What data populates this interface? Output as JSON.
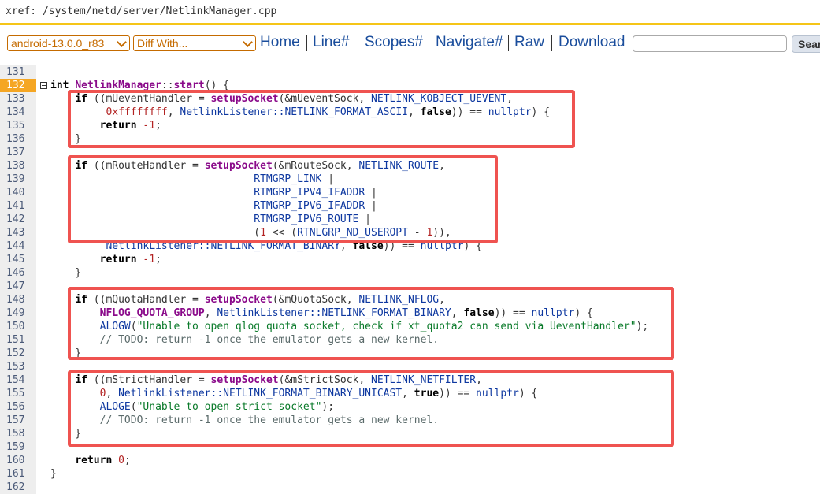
{
  "header": {
    "xref_path": "xref: /system/netd/server/NetlinkManager.cpp"
  },
  "toolbar": {
    "branch_select": "android-13.0.0_r83",
    "diff_select": "Diff With...",
    "links": [
      "Home",
      "Line#",
      "Scopes#",
      "Navigate#",
      "Raw",
      "Download"
    ],
    "search_button": "Search"
  },
  "code": {
    "highlighted_line": "132",
    "lines": [
      {
        "n": "131",
        "segs": []
      },
      {
        "n": "132",
        "segs": [
          [
            "k",
            "int "
          ],
          [
            "fn",
            "NetlinkManager"
          ],
          [
            "p",
            "::"
          ],
          [
            "fn",
            "start"
          ],
          [
            "p",
            "() {"
          ]
        ]
      },
      {
        "n": "133",
        "segs": [
          [
            "p",
            "    "
          ],
          [
            "k",
            "if"
          ],
          [
            "p",
            " (("
          ],
          [
            "mem",
            "mUeventHandler"
          ],
          [
            "p",
            " = "
          ],
          [
            "fn",
            "setupSocket"
          ],
          [
            "p",
            "(&"
          ],
          [
            "mem",
            "mUeventSock"
          ],
          [
            "p",
            ", "
          ],
          [
            "cst",
            "NETLINK_KOBJECT_UEVENT"
          ],
          [
            "p",
            ","
          ]
        ]
      },
      {
        "n": "134",
        "segs": [
          [
            "p",
            "         "
          ],
          [
            "num",
            "0xffffffff"
          ],
          [
            "p",
            ", "
          ],
          [
            "cst",
            "NetlinkListener::NETLINK_FORMAT_ASCII"
          ],
          [
            "p",
            ", "
          ],
          [
            "k",
            "false"
          ],
          [
            "p",
            ")) == "
          ],
          [
            "cst",
            "nullptr"
          ],
          [
            "p",
            ") {"
          ]
        ]
      },
      {
        "n": "135",
        "segs": [
          [
            "p",
            "        "
          ],
          [
            "k",
            "return"
          ],
          [
            "p",
            " "
          ],
          [
            "num",
            "-1"
          ],
          [
            "p",
            ";"
          ]
        ]
      },
      {
        "n": "136",
        "segs": [
          [
            "p",
            "    }"
          ]
        ]
      },
      {
        "n": "137",
        "segs": []
      },
      {
        "n": "138",
        "segs": [
          [
            "p",
            "    "
          ],
          [
            "k",
            "if"
          ],
          [
            "p",
            " (("
          ],
          [
            "mem",
            "mRouteHandler"
          ],
          [
            "p",
            " = "
          ],
          [
            "fn",
            "setupSocket"
          ],
          [
            "p",
            "(&"
          ],
          [
            "mem",
            "mRouteSock"
          ],
          [
            "p",
            ", "
          ],
          [
            "cst",
            "NETLINK_ROUTE"
          ],
          [
            "p",
            ","
          ]
        ]
      },
      {
        "n": "139",
        "segs": [
          [
            "p",
            "                                 "
          ],
          [
            "cst",
            "RTMGRP_LINK"
          ],
          [
            "p",
            " |"
          ]
        ]
      },
      {
        "n": "140",
        "segs": [
          [
            "p",
            "                                 "
          ],
          [
            "cst",
            "RTMGRP_IPV4_IFADDR"
          ],
          [
            "p",
            " |"
          ]
        ]
      },
      {
        "n": "141",
        "segs": [
          [
            "p",
            "                                 "
          ],
          [
            "cst",
            "RTMGRP_IPV6_IFADDR"
          ],
          [
            "p",
            " |"
          ]
        ]
      },
      {
        "n": "142",
        "segs": [
          [
            "p",
            "                                 "
          ],
          [
            "cst",
            "RTMGRP_IPV6_ROUTE"
          ],
          [
            "p",
            " |"
          ]
        ]
      },
      {
        "n": "143",
        "segs": [
          [
            "p",
            "                                 ("
          ],
          [
            "num",
            "1"
          ],
          [
            "p",
            " << ("
          ],
          [
            "cst",
            "RTNLGRP_ND_USEROPT"
          ],
          [
            "p",
            " - "
          ],
          [
            "num",
            "1"
          ],
          [
            "p",
            ")),"
          ]
        ]
      },
      {
        "n": "144",
        "segs": [
          [
            "p",
            "         "
          ],
          [
            "cst",
            "NetlinkListener::NETLINK_FORMAT_BINARY"
          ],
          [
            "p",
            ", "
          ],
          [
            "k",
            "false"
          ],
          [
            "p",
            ")) == "
          ],
          [
            "cst",
            "nullptr"
          ],
          [
            "p",
            ") {"
          ]
        ]
      },
      {
        "n": "145",
        "segs": [
          [
            "p",
            "        "
          ],
          [
            "k",
            "return"
          ],
          [
            "p",
            " "
          ],
          [
            "num",
            "-1"
          ],
          [
            "p",
            ";"
          ]
        ]
      },
      {
        "n": "146",
        "segs": [
          [
            "p",
            "    }"
          ]
        ]
      },
      {
        "n": "147",
        "segs": []
      },
      {
        "n": "148",
        "segs": [
          [
            "p",
            "    "
          ],
          [
            "k",
            "if"
          ],
          [
            "p",
            " (("
          ],
          [
            "mem",
            "mQuotaHandler"
          ],
          [
            "p",
            " = "
          ],
          [
            "fn",
            "setupSocket"
          ],
          [
            "p",
            "(&"
          ],
          [
            "mem",
            "mQuotaSock"
          ],
          [
            "p",
            ", "
          ],
          [
            "cst",
            "NETLINK_NFLOG"
          ],
          [
            "p",
            ","
          ]
        ]
      },
      {
        "n": "149",
        "segs": [
          [
            "p",
            "        "
          ],
          [
            "fn",
            "NFLOG_QUOTA_GROUP"
          ],
          [
            "p",
            ", "
          ],
          [
            "cst",
            "NetlinkListener::NETLINK_FORMAT_BINARY"
          ],
          [
            "p",
            ", "
          ],
          [
            "k",
            "false"
          ],
          [
            "p",
            ")) == "
          ],
          [
            "cst",
            "nullptr"
          ],
          [
            "p",
            ") {"
          ]
        ]
      },
      {
        "n": "150",
        "segs": [
          [
            "p",
            "        "
          ],
          [
            "cst",
            "ALOGW"
          ],
          [
            "p",
            "("
          ],
          [
            "str",
            "\"Unable to open qlog quota socket, check if xt_quota2 can send via UeventHandler\""
          ],
          [
            "p",
            ");"
          ]
        ]
      },
      {
        "n": "151",
        "segs": [
          [
            "p",
            "        "
          ],
          [
            "cmt",
            "// TODO: return -1 once the emulator gets a new kernel."
          ]
        ]
      },
      {
        "n": "152",
        "segs": [
          [
            "p",
            "    }"
          ]
        ]
      },
      {
        "n": "153",
        "segs": []
      },
      {
        "n": "154",
        "segs": [
          [
            "p",
            "    "
          ],
          [
            "k",
            "if"
          ],
          [
            "p",
            " (("
          ],
          [
            "mem",
            "mStrictHandler"
          ],
          [
            "p",
            " = "
          ],
          [
            "fn",
            "setupSocket"
          ],
          [
            "p",
            "(&"
          ],
          [
            "mem",
            "mStrictSock"
          ],
          [
            "p",
            ", "
          ],
          [
            "cst",
            "NETLINK_NETFILTER"
          ],
          [
            "p",
            ","
          ]
        ]
      },
      {
        "n": "155",
        "segs": [
          [
            "p",
            "        "
          ],
          [
            "num",
            "0"
          ],
          [
            "p",
            ", "
          ],
          [
            "cst",
            "NetlinkListener::NETLINK_FORMAT_BINARY_UNICAST"
          ],
          [
            "p",
            ", "
          ],
          [
            "k",
            "true"
          ],
          [
            "p",
            ")) == "
          ],
          [
            "cst",
            "nullptr"
          ],
          [
            "p",
            ") {"
          ]
        ]
      },
      {
        "n": "156",
        "segs": [
          [
            "p",
            "        "
          ],
          [
            "cst",
            "ALOGE"
          ],
          [
            "p",
            "("
          ],
          [
            "str",
            "\"Unable to open strict socket\""
          ],
          [
            "p",
            ");"
          ]
        ]
      },
      {
        "n": "157",
        "segs": [
          [
            "p",
            "        "
          ],
          [
            "cmt",
            "// TODO: return -1 once the emulator gets a new kernel."
          ]
        ]
      },
      {
        "n": "158",
        "segs": [
          [
            "p",
            "    }"
          ]
        ]
      },
      {
        "n": "159",
        "segs": []
      },
      {
        "n": "160",
        "segs": [
          [
            "p",
            "    "
          ],
          [
            "k",
            "return"
          ],
          [
            "p",
            " "
          ],
          [
            "num",
            "0"
          ],
          [
            "p",
            ";"
          ]
        ]
      },
      {
        "n": "161",
        "segs": [
          [
            "p",
            "}"
          ]
        ]
      },
      {
        "n": "162",
        "segs": []
      }
    ]
  },
  "annotation_color": "#ef5350"
}
